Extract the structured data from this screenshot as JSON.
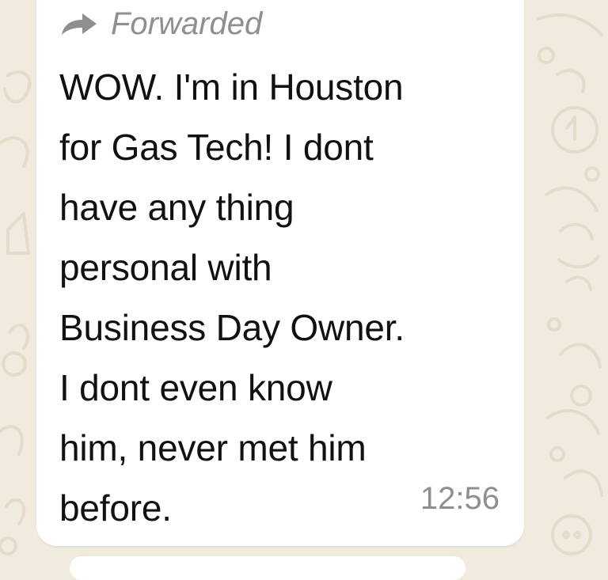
{
  "colors": {
    "wallpaper": "#f1ebdf",
    "wallpaper_pattern": "#e4dbc9",
    "bubble": "#ffffff",
    "text": "#111111",
    "meta_text": "#8f8f8f"
  },
  "message": {
    "forwarded_icon": "forward-arrow-icon",
    "forwarded_label": "Forwarded",
    "lines": [
      "WOW. I'm in Houston",
      "for Gas Tech! I dont",
      "have any thing",
      "personal with",
      "Business Day Owner.",
      "I dont even know",
      "him, never met him",
      "before."
    ],
    "time": "12:56"
  }
}
